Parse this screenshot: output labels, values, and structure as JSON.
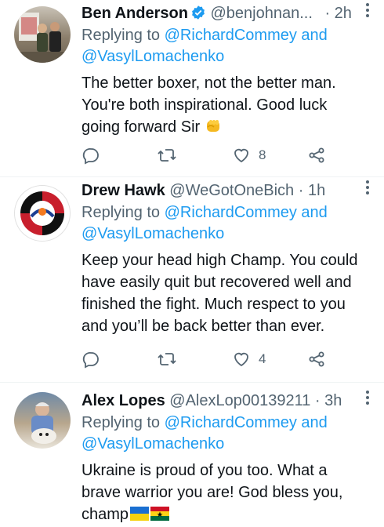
{
  "tweets": [
    {
      "name": "Ben Anderson",
      "handle": "@benjohnan...",
      "time": "· 2h",
      "verified": true,
      "reply_prefix": "Replying to",
      "reply_to_1": "@RichardCommey and",
      "reply_to_2": "@VasylLomachenko",
      "text_lines": [
        "The better boxer, not the better man.",
        "You're both inspirational. Good luck",
        "going forward Sir"
      ],
      "emoji": "fist-emoji",
      "likes": "8"
    },
    {
      "name": "Drew Hawk",
      "handle": "@WeGotOneBich",
      "time": "· 1h",
      "reply_prefix": "Replying to",
      "reply_to_1": "@RichardCommey and",
      "reply_to_2": "@VasylLomachenko",
      "text_lines": [
        "Keep your head high Champ. You could",
        "have easily quit but recovered well and",
        "finished the fight. Much respect to you",
        "and you’ll be back better than ever."
      ],
      "likes": "4"
    },
    {
      "name": "Alex Lopes",
      "handle": "@AlexLop00139211",
      "time": "· 3h",
      "reply_prefix": "Replying to",
      "reply_to_1": "@RichardCommey and",
      "reply_to_2": "@VasylLomachenko",
      "text_lines": [
        "Ukraine is proud of you too. What a",
        "brave warrior you are! God bless you,",
        "champ"
      ],
      "flags": [
        "ukraine-flag",
        "ghana-flag"
      ]
    }
  ],
  "icons": [
    "reply-icon",
    "retweet-icon",
    "like-icon",
    "share-icon",
    "more-icon",
    "verified-icon"
  ],
  "colors": {
    "link": "#1d9bf0",
    "secondary": "#536471",
    "text": "#0f1419",
    "divider": "#eff3f4"
  }
}
